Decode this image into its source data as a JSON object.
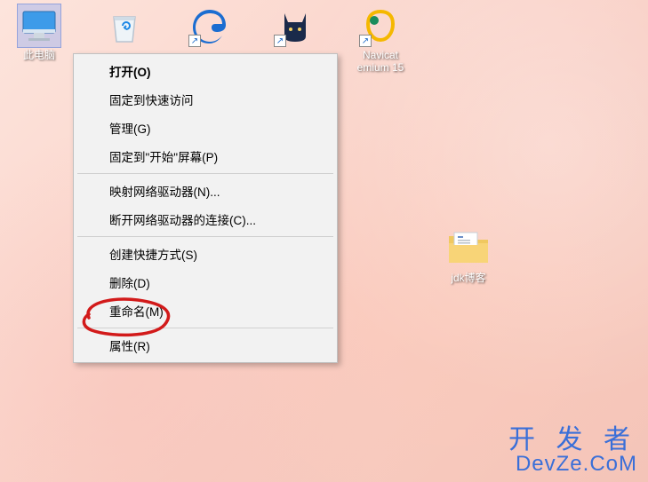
{
  "desktop": {
    "icons": [
      {
        "label": "此电脑",
        "name": "this-pc"
      },
      {
        "label": "",
        "name": "recycle-bin"
      },
      {
        "label": "",
        "name": "edge"
      },
      {
        "label": "",
        "name": "clash"
      },
      {
        "label": "Navicat\nemium 15",
        "name": "navicat"
      }
    ],
    "folder": {
      "label": "jdk博客"
    }
  },
  "context_menu": {
    "groups": [
      [
        {
          "label": "打开(O)",
          "bold": true
        },
        {
          "label": "固定到快速访问"
        },
        {
          "label": "管理(G)"
        },
        {
          "label": "固定到\"开始\"屏幕(P)"
        }
      ],
      [
        {
          "label": "映射网络驱动器(N)..."
        },
        {
          "label": "断开网络驱动器的连接(C)..."
        }
      ],
      [
        {
          "label": "创建快捷方式(S)"
        },
        {
          "label": "删除(D)"
        },
        {
          "label": "重命名(M)"
        }
      ],
      [
        {
          "label": "属性(R)"
        }
      ]
    ]
  },
  "watermark": {
    "line1": "开 发 者",
    "line2": "DevZe.CoM"
  }
}
